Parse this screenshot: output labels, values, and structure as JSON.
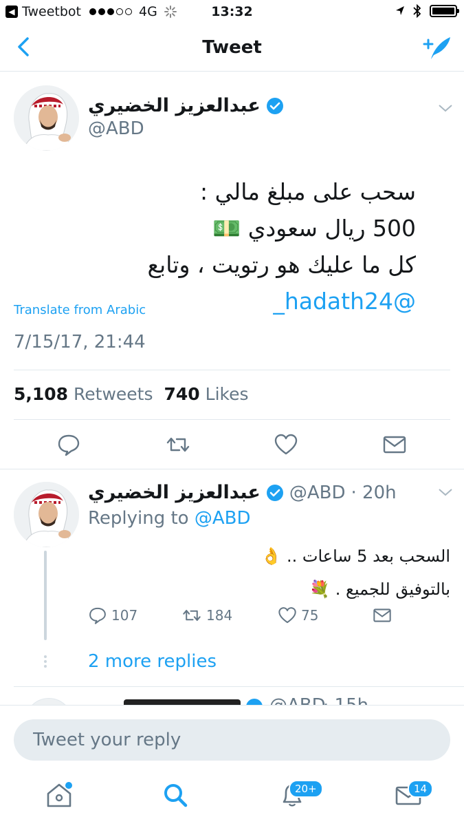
{
  "status_bar": {
    "back_app": "Tweetbot",
    "network": "4G",
    "time": "13:32"
  },
  "nav": {
    "title": "Tweet"
  },
  "main_tweet": {
    "author_name": "عبدالعزيز الخضيري",
    "handle": "@ABD",
    "body_line1": "سحب على مبلغ مالي :",
    "body_line2": "500 ريال سعودي 💵",
    "body_line3_text": "كل ما عليك هو رتويت ، وتابع",
    "body_line3_mention": "@hadath24_",
    "translate": "Translate from Arabic",
    "timestamp": "7/15/17, 21:44",
    "retweets_count": "5,108",
    "retweets_label": "Retweets",
    "likes_count": "740",
    "likes_label": "Likes"
  },
  "reply_tweet": {
    "author_name": "عبدالعزيز الخضيري",
    "handle": "@ABD",
    "time": "· 20h",
    "replying_prefix": "Replying to",
    "replying_to": "@ABD",
    "body_line1": "السحب بعد 5 ساعات .. 👌",
    "body_line2": "بالتوفيق للجميع . 💐",
    "replies": "107",
    "retweets": "184",
    "likes": "75",
    "more_replies": "2 more replies"
  },
  "partial_tweet": {
    "handle": "@ABD",
    "time": "· 15h"
  },
  "composer": {
    "placeholder": "Tweet your reply"
  },
  "tab_bar": {
    "notifications_badge": "20+",
    "messages_badge": "14"
  },
  "colors": {
    "accent": "#1da1f2",
    "secondary_text": "#657786",
    "divider": "#e1e8ed"
  }
}
